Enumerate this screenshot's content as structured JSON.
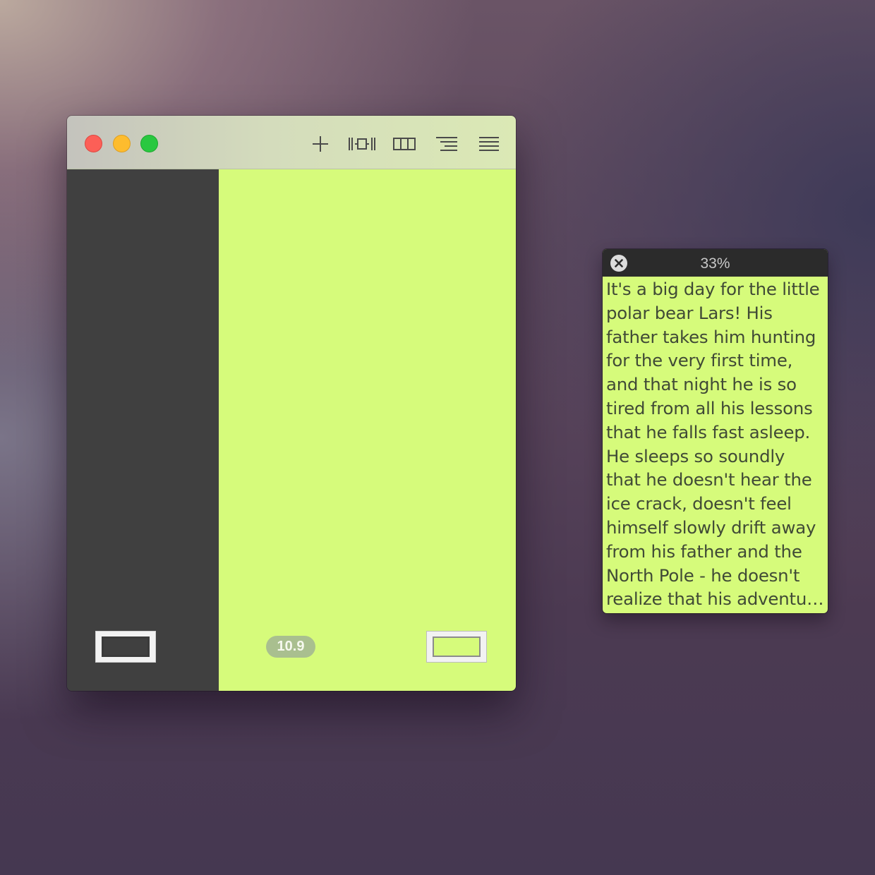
{
  "toolbar": {
    "icons": [
      "plus-icon",
      "focus-width-icon",
      "columns-icon",
      "outline-icon",
      "list-icon"
    ]
  },
  "editor": {
    "version_badge": "10.9"
  },
  "preview": {
    "percent": "33%",
    "lines": [
      "It's a big day for the little",
      "polar bear Lars! His",
      "father takes him hunting",
      "for the very first time,",
      "and that night he is so",
      "tired from all his lessons",
      "that he falls fast asleep.",
      "He sleeps so soundly",
      "that he doesn't hear the",
      "ice crack, doesn't feel",
      "himself slowly drift away",
      "from his father and the",
      "North Pole - he doesn't",
      "realize that his adventur..."
    ]
  },
  "colors": {
    "editor_background": "#d6fb7b",
    "sidebar_background": "#404040",
    "close": "#fc5f57",
    "minimize": "#fdbc2e",
    "maximize": "#29c840"
  }
}
